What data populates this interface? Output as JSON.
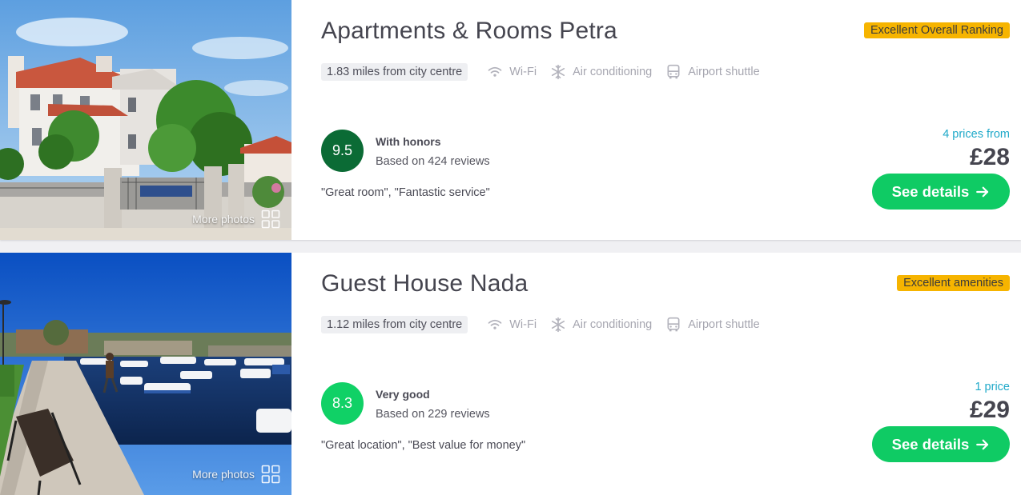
{
  "listings": [
    {
      "name": "Apartments & Rooms Petra",
      "badge": "Excellent Overall Ranking",
      "distance": "1.83 miles from city centre",
      "amenities": [
        {
          "icon": "wifi-icon",
          "label": "Wi-Fi"
        },
        {
          "icon": "snowflake-icon",
          "label": "Air conditioning"
        },
        {
          "icon": "bus-icon",
          "label": "Airport shuttle"
        }
      ],
      "score": "9.5",
      "rating_label": "With honors",
      "reviews": "Based on 424 reviews",
      "quote": "\"Great room\", \"Fantastic service\"",
      "prices_from": "4 prices from",
      "price": "£28",
      "details_label": "See details",
      "more_photos": "More photos"
    },
    {
      "name": "Guest House Nada",
      "badge": "Excellent amenities",
      "distance": "1.12 miles from city centre",
      "amenities": [
        {
          "icon": "wifi-icon",
          "label": "Wi-Fi"
        },
        {
          "icon": "snowflake-icon",
          "label": "Air conditioning"
        },
        {
          "icon": "bus-icon",
          "label": "Airport shuttle"
        }
      ],
      "score": "8.3",
      "rating_label": "Very good",
      "reviews": "Based on 229 reviews",
      "quote": "\"Great location\", \"Best value for money\"",
      "prices_from": "1 price",
      "price": "£29",
      "details_label": "See details",
      "more_photos": "More photos"
    }
  ],
  "colors": {
    "accent_green": "#0fcb64",
    "score_dark": "#0b6b35",
    "score_light": "#10d166",
    "badge_yellow": "#f6b400",
    "link_blue": "#1fa9c9"
  }
}
